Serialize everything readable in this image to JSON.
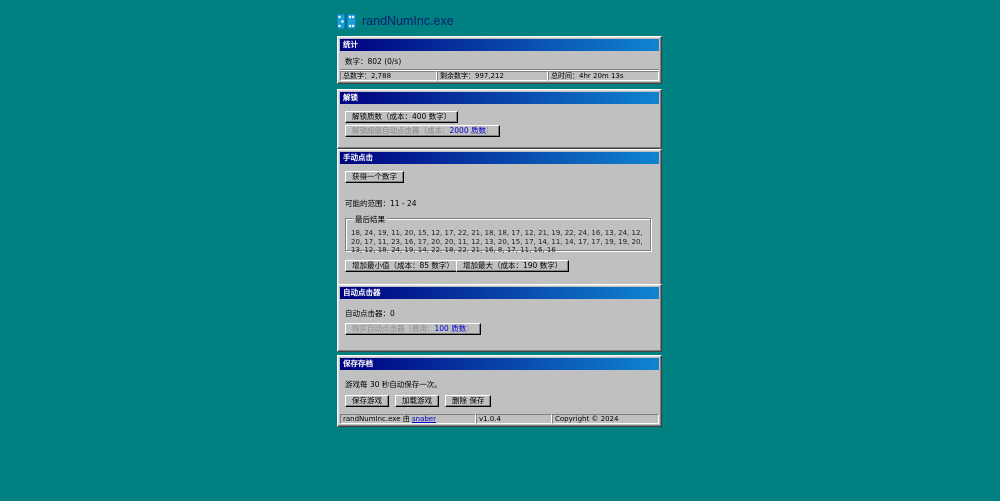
{
  "app": {
    "title": "randNumInc.exe"
  },
  "stats": {
    "title": "统计",
    "numbers_line": "数字：802 (0/s)",
    "total_numbers": "总数字：2,788",
    "remaining_numbers": "剩余数字：997,212",
    "total_time": "总时间：4hr 20m 13s"
  },
  "unlocks": {
    "title": "解锁",
    "unlock_primes_label": "解锁质数（成本：400 数字）",
    "unlock_super_prefix": "解锁超级自动点击器（成本：",
    "unlock_super_cost": "2000 质数",
    "unlock_super_suffix": "）"
  },
  "manual": {
    "title": "手动点击",
    "get_number_label": "获得一个数字",
    "range_line": "可能的范围：11 - 24",
    "recent_legend": "最后结果",
    "recent_results": "18, 24, 19, 11, 20, 15, 12, 17, 22, 21, 18, 18, 17, 12, 21, 19, 22, 24, 16, 13, 24, 12, 20, 17, 11, 23, 16, 17, 20, 20, 11, 12, 13, 20, 15, 17, 14, 11, 14, 17, 17, 19, 19, 20, 13, 12, 18, 24, 19, 14, 22, 18, 22, 21, 16, 8, 17, 11, 16, 16",
    "increase_min_label": "增加最小值（成本：85 数字）",
    "increase_max_label": "增加最大（成本：190 数字）"
  },
  "autoclicker": {
    "title": "自动点击器",
    "count_line": "自动点击器：0",
    "buy_prefix": "购买自动点击器（费用：",
    "buy_cost": "100 质数",
    "buy_suffix": "）"
  },
  "save": {
    "title": "保存存档",
    "info": "游戏每 30 秒自动保存一次。",
    "save_label": "保存游戏",
    "load_label": "加载游戏",
    "delete_label": "删除 保存",
    "credit_prefix": "randNumInc.exe 由 ",
    "credit_author": "snaber",
    "version": "v1.0.4",
    "copyright": "Copyright © 2024"
  },
  "colors": {
    "desktop": "#008080",
    "window": "#c0c0c0",
    "titlebar_start": "#000080",
    "titlebar_end": "#1084d0"
  },
  "icons": {
    "logo": "dice-icon"
  }
}
